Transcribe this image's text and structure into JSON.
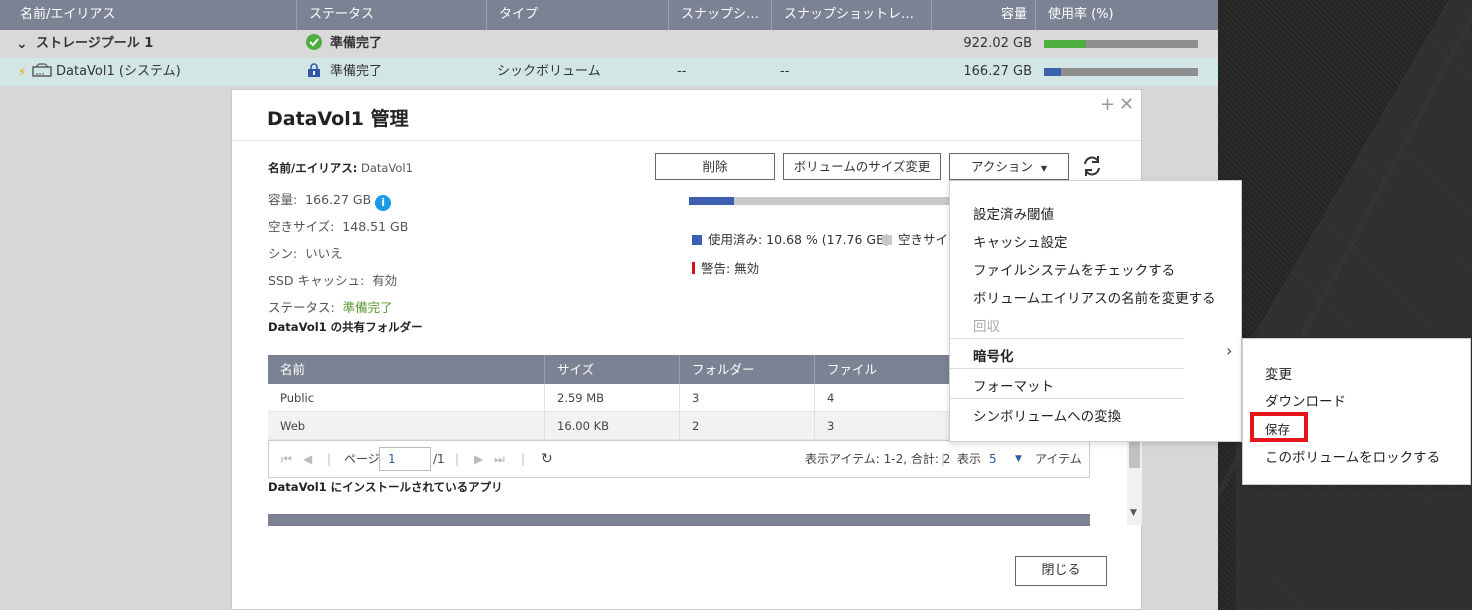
{
  "colors": {
    "header_bg": "#7b8294",
    "selected_row": "#d3e6e6",
    "green": "#4caf3e",
    "blue": "#3d5fb0",
    "highlight": "#e8141b"
  },
  "storage_table": {
    "columns": [
      "名前/エイリアス",
      "ステータス",
      "タイプ",
      "スナップシ…",
      "スナップショットレ…",
      "容量",
      "使用率 (%)"
    ],
    "pool": {
      "name": "ストレージプール 1",
      "status": "準備完了",
      "capacity": "922.02 GB",
      "usage": 0.27
    },
    "volume": {
      "name": "DataVol1 (システム)",
      "status": "準備完了",
      "type": "シックボリューム",
      "snap1": "--",
      "snap2": "--",
      "capacity": "166.27 GB",
      "usage": 0.11
    }
  },
  "dialog": {
    "title": "DataVol1  管理",
    "name_label": "名前/エイリアス:",
    "name_value": "DataVol1",
    "capacity_label": "容量:",
    "capacity_value": "166.27 GB",
    "free_label": "空きサイズ:",
    "free_value": "148.51 GB",
    "thin_label": "シン:",
    "thin_value": "いいえ",
    "ssd_label": "SSD キャッシュ:",
    "ssd_value": "有効",
    "status_label": "ステータス:",
    "status_value": "準備完了",
    "buttons": {
      "delete": "削除",
      "resize": "ボリュームのサイズ変更",
      "action": "アクション",
      "close": "閉じる"
    },
    "usage": {
      "used_legend": "使用済み: 10.68 % (17.76 GB)",
      "free_legend": "空きサイズ",
      "warning_legend": "警告: 無効",
      "used_fraction": 0.1068
    },
    "shared_folder_title": "DataVol1 の共有フォルダー",
    "shared_columns": [
      "名前",
      "サイズ",
      "フォルダー",
      "ファイル"
    ],
    "shared_rows": [
      {
        "name": "Public",
        "size": "2.59 MB",
        "folders": "3",
        "files": "4"
      },
      {
        "name": "Web",
        "size": "16.00 KB",
        "folders": "2",
        "files": "3"
      }
    ],
    "pager": {
      "page_label": "ページ",
      "page": "1",
      "total": "/1",
      "items_label": "表示アイテム: 1-2, 合計: 2",
      "show_label": "表示",
      "per_page": "5",
      "items_suffix": "アイテム"
    },
    "apps_title": "DataVol1 にインストールされているアプリ"
  },
  "action_menu": {
    "items": [
      "設定済み閾値",
      "キャッシュ設定",
      "ファイルシステムをチェックする",
      "ボリュームエイリアスの名前を変更する",
      "回収",
      "暗号化",
      "フォーマット",
      "シンボリュームへの変換"
    ]
  },
  "encryption_submenu": {
    "items": [
      "変更",
      "ダウンロード",
      "保存",
      "このボリュームをロックする"
    ],
    "highlighted": "保存"
  }
}
